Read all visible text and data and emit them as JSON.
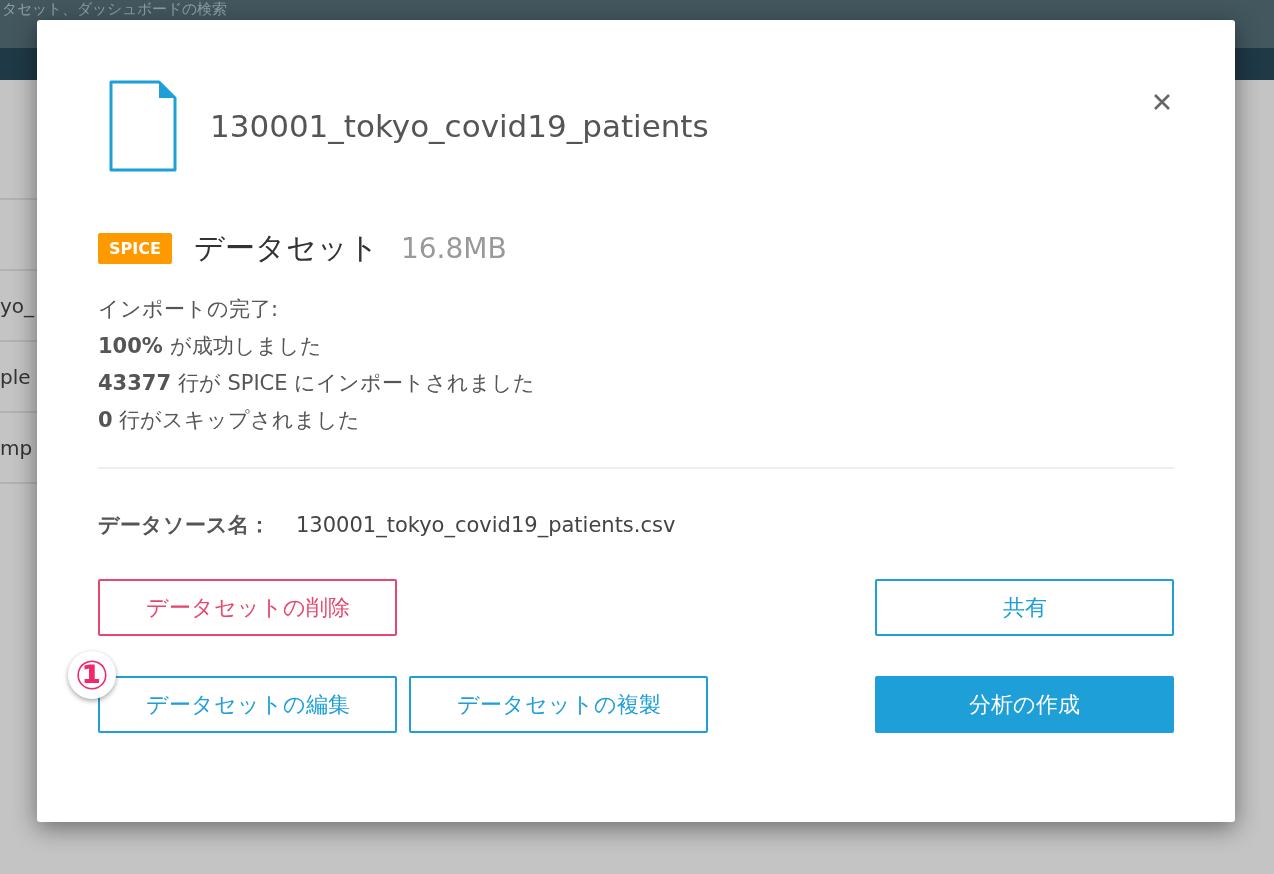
{
  "header": {
    "search_text": "タセット、ダッシュボードの検索"
  },
  "background_rows": [
    "",
    "yo_",
    "ple",
    "mp",
    ""
  ],
  "dialog": {
    "title": "130001_tokyo_covid19_patients",
    "badge": "SPICE",
    "subtitle": "データセット",
    "size": "16.8MB",
    "import_lines": [
      "インポートの完了:",
      "**100%** が成功しました",
      "**43377** 行が SPICE にインポートされました",
      "**0** 行がスキップされました"
    ],
    "source_label": "データソース名：",
    "source_value": "130001_tokyo_covid19_patients.csv",
    "button_rows": [
      {
        "left": [
          {
            "label": "データセットの削除",
            "kind": "danger"
          }
        ],
        "right": [
          {
            "label": "共有",
            "kind": "outline"
          }
        ]
      },
      {
        "left": [
          {
            "label": "データセットの編集",
            "kind": "outline",
            "marker": "①"
          },
          {
            "label": "データセットの複製",
            "kind": "outline"
          }
        ],
        "right": [
          {
            "label": "分析の作成",
            "kind": "primary"
          }
        ]
      }
    ]
  }
}
